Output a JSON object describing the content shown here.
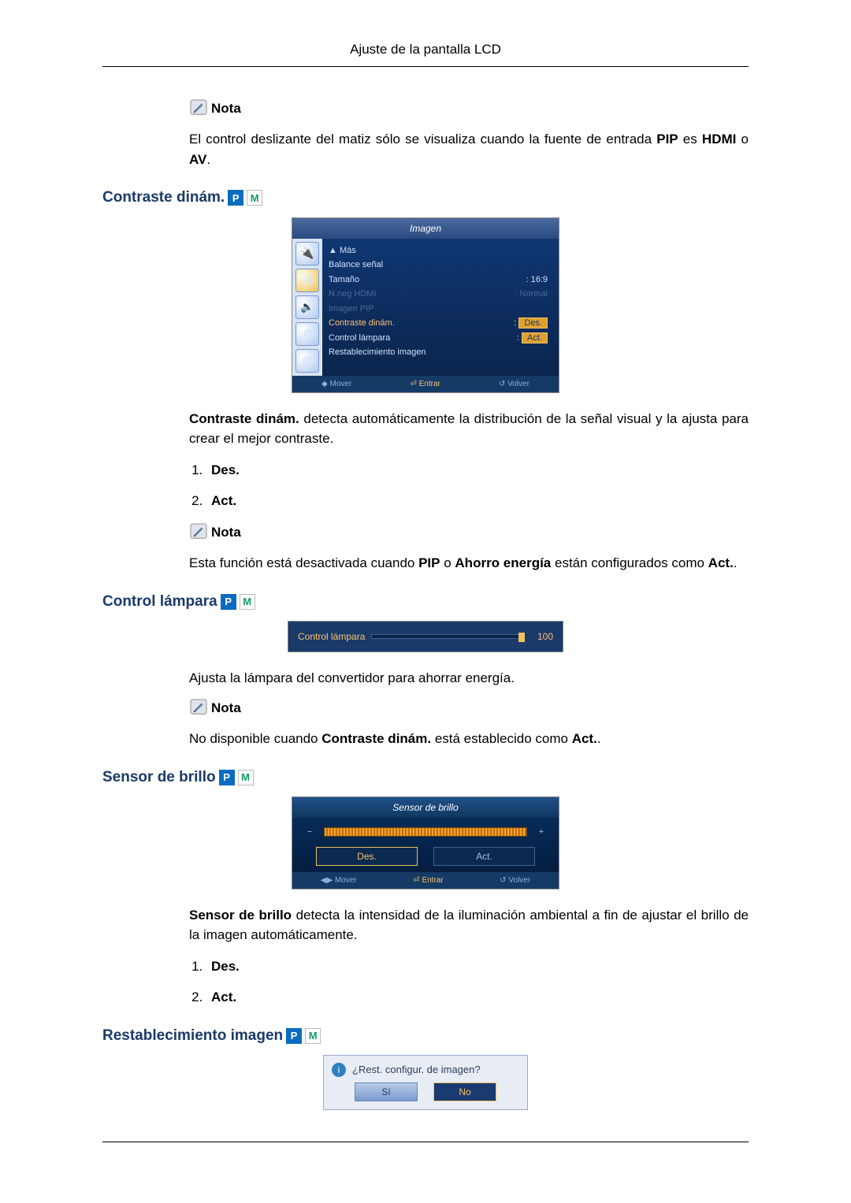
{
  "page": {
    "header": "Ajuste de la pantalla LCD"
  },
  "note_label": "Nota",
  "badges": {
    "p": "P",
    "m": "M"
  },
  "intro_note": {
    "pre": "El control deslizante del matiz sólo se visualiza cuando la fuente de entrada ",
    "pip": "PIP",
    "mid": " es ",
    "hdmi": "HDMI",
    "or": " o ",
    "av": "AV",
    "end": "."
  },
  "sec_contraste": {
    "title": "Contraste dinám.",
    "osd": {
      "title": "Imagen",
      "mas": "▲ Más",
      "rows": {
        "balance": "Balance señal",
        "tamano_l": "Tamaño",
        "tamano_v": "16:9",
        "nneg_l": "N.neg HDMI",
        "nneg_v": "Normal",
        "pip_l": "Imagen PIP",
        "cd_l": "Contraste dinám.",
        "cd_v": "Des.",
        "cl_l": "Control lámpara",
        "cl_v": "Act.",
        "reset": "Restablecimiento imagen"
      },
      "foot": {
        "mover": "Mover",
        "entrar": "Entrar",
        "volver": "Volver"
      }
    },
    "desc_b": "Contraste dinám.",
    "desc_rest": " detecta automáticamente la distribución de la señal visual y la ajusta para crear el mejor contraste.",
    "opt1": "Des.",
    "opt2": "Act.",
    "note2": {
      "pre": "Esta función está desactivada cuando ",
      "pip": "PIP",
      "or": " o ",
      "ae": "Ahorro energía",
      "mid": " están configurados como ",
      "act": "Act.",
      "end": "."
    }
  },
  "sec_lampara": {
    "title": "Control lámpara",
    "slider_label": "Control lámpara",
    "slider_value": "100",
    "desc": "Ajusta la lámpara del convertidor para ahorrar energía.",
    "note": {
      "pre": "No disponible cuando ",
      "cd": "Contraste dinám.",
      "mid": " está establecido como ",
      "act": "Act.",
      "end": "."
    }
  },
  "sec_sensor": {
    "title": "Sensor de brillo",
    "osd_title": "Sensor de brillo",
    "btn_des": "Des.",
    "btn_act": "Act.",
    "foot": {
      "mover": "Mover",
      "entrar": "Entrar",
      "volver": "Volver"
    },
    "desc_b": "Sensor de brillo",
    "desc_rest": " detecta la intensidad de la iluminación ambiental a fin de ajustar el brillo de la imagen automáticamente.",
    "opt1": "Des.",
    "opt2": "Act."
  },
  "sec_reset": {
    "title": "Restablecimiento imagen",
    "question": "¿Rest. configur. de imagen?",
    "yes": "Sí",
    "no": "No"
  }
}
